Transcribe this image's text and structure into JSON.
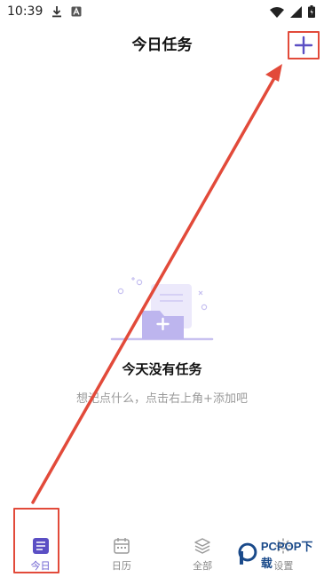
{
  "status_bar": {
    "time": "10:39"
  },
  "header": {
    "title": "今日任务"
  },
  "empty_state": {
    "title": "今天没有任务",
    "hint": "想记点什么，点击右上角+添加吧"
  },
  "tabs": [
    {
      "label": "今日",
      "icon": "today-list-icon",
      "active": true
    },
    {
      "label": "日历",
      "icon": "calendar-icon",
      "active": false
    },
    {
      "label": "全部",
      "icon": "layers-icon",
      "active": false
    },
    {
      "label": "设置",
      "icon": "gear-icon",
      "active": false
    }
  ],
  "watermark": {
    "text": "PCPOP下载"
  },
  "colors": {
    "accent": "#6b5fd0",
    "annotation": "#e24a3a"
  }
}
